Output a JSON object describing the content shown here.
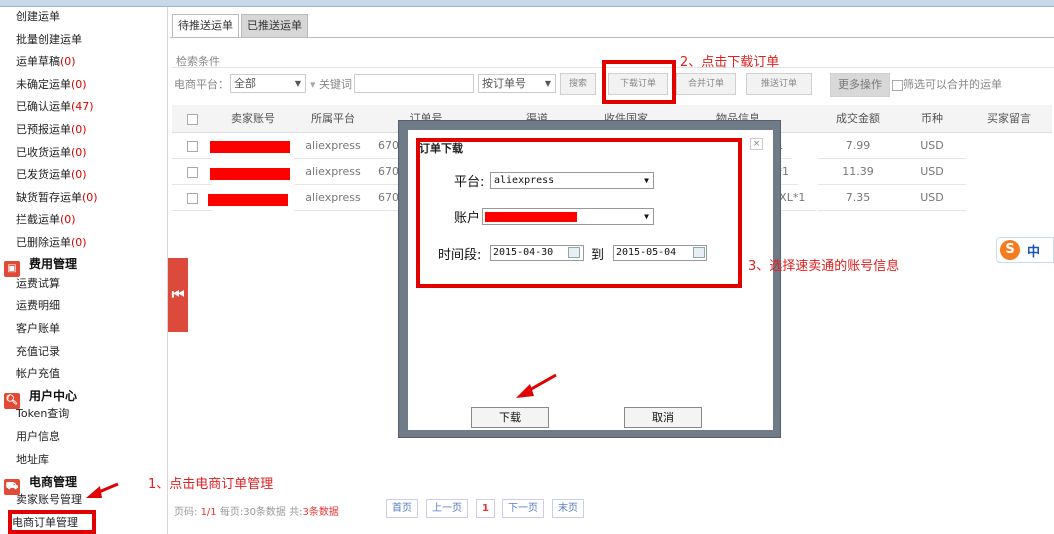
{
  "sidebar": {
    "items_top": [
      {
        "label": "创建运单",
        "count": ""
      },
      {
        "label": "批量创建运单",
        "count": ""
      },
      {
        "label": "运单草稿",
        "count": "(0)"
      },
      {
        "label": "未确定运单",
        "count": "(0)"
      },
      {
        "label": "已确认运单",
        "count": "(47)"
      },
      {
        "label": "已预报运单",
        "count": "(0)"
      },
      {
        "label": "已收货运单",
        "count": "(0)"
      },
      {
        "label": "已发货运单",
        "count": "(0)"
      },
      {
        "label": "缺货暂存运单",
        "count": "(0)"
      },
      {
        "label": "拦截运单",
        "count": "(0)"
      },
      {
        "label": "已删除运单",
        "count": "(0)"
      }
    ],
    "section_fee": "费用管理",
    "fee_items": [
      "运费试算",
      "运费明细",
      "客户账单",
      "充值记录",
      "帐户充值"
    ],
    "section_user": "用户中心",
    "user_items": [
      "Token查询",
      "用户信息",
      "地址库"
    ],
    "section_ecom": "电商管理",
    "ecom_items": [
      "卖家账号管理",
      "电商订单管理"
    ]
  },
  "tabs": [
    "待推送运单",
    "已推送运单"
  ],
  "search": {
    "title": "检索条件",
    "platform_label": "电商平台：",
    "platform_value": "全部",
    "keyword_label": "关键词：",
    "keyword_value": "",
    "order_by": "按订单号",
    "search_btn": "搜索",
    "download_btn": "下载订单",
    "merge_btn": "合并订单",
    "push_btn": "推送订单",
    "more_btn": "更多操作",
    "filter_label": "筛选可以合并的运单"
  },
  "table": {
    "headers": [
      "卖家账号",
      "所属平台",
      "订单号",
      "渠道",
      "收件国家",
      "物品信息",
      "成交金额",
      "币种",
      "买家留言"
    ],
    "rows": [
      {
        "platform": "aliexpress",
        "order": "6704",
        "item": "*1",
        "amount": "7.99",
        "currency": "USD"
      },
      {
        "platform": "aliexpress",
        "order": "6704",
        "item": "M*1",
        "amount": "11.39",
        "currency": "USD"
      },
      {
        "platform": "aliexpress",
        "order": "6704",
        "item": "_3XL*1",
        "amount": "7.35",
        "currency": "USD"
      }
    ]
  },
  "pager": {
    "prefix": "页码:",
    "page": "1/1",
    "mid": "每页:30条数据 共:",
    "total": "3条数据",
    "first": "首页",
    "prev": "上一页",
    "current": "1",
    "next": "下一页",
    "last": "末页"
  },
  "dialog": {
    "title": "订单下载",
    "platform_label": "平台:",
    "platform_value": "aliexpress",
    "account_label": "账户",
    "period_label": "时间段:",
    "date_from": "2015-04-30",
    "to_label": "到",
    "date_to": "2015-05-04",
    "download_btn": "下载",
    "cancel_btn": "取消",
    "close": "×"
  },
  "annotations": {
    "step1": "1、点击电商订单管理",
    "step2": "2、点击下载订单",
    "step3": "3、选择速卖通的账号信息"
  },
  "ime": {
    "logo": "S",
    "text": "中"
  },
  "colors": {
    "red_mark": "#e00000",
    "collapse": "#dc4a3c",
    "link": "#5a7cc5"
  }
}
